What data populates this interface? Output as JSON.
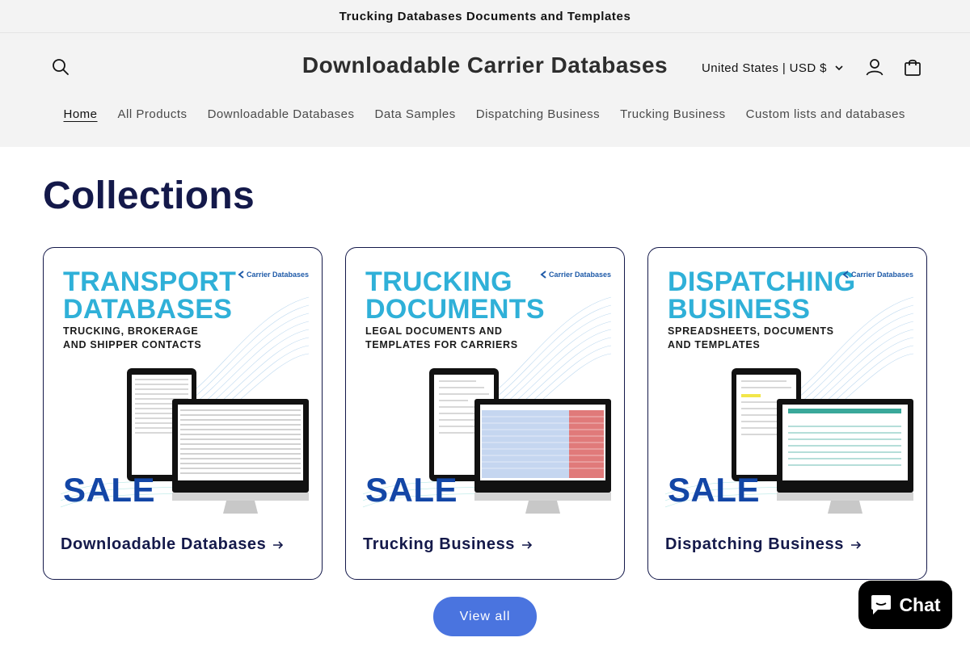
{
  "announcement": {
    "text": "Trucking Databases Documents and Templates"
  },
  "header": {
    "site_title": "Downloadable Carrier Databases",
    "locale": "United States | USD $",
    "icons": {
      "search": "search-icon",
      "account": "account-icon",
      "cart": "cart-icon",
      "locale_chevron": "chevron-down-icon"
    }
  },
  "nav": {
    "items": [
      {
        "label": "Home",
        "active": true
      },
      {
        "label": "All Products"
      },
      {
        "label": "Downloadable Databases"
      },
      {
        "label": "Data Samples"
      },
      {
        "label": "Dispatching Business"
      },
      {
        "label": "Trucking Business"
      },
      {
        "label": "Custom lists and databases"
      }
    ]
  },
  "main": {
    "title": "Collections",
    "cards": [
      {
        "label": "Downloadable Databases",
        "image": {
          "heading_line1": "TRANSPORT",
          "heading_line2": "DATABASES",
          "sub_line1": "TRUCKING, BROKERAGE",
          "sub_line2": "AND SHIPPER CONTACTS",
          "brand": "Carrier Databases",
          "sale": "SALE"
        }
      },
      {
        "label": "Trucking Business",
        "image": {
          "heading_line1": "TRUCKING",
          "heading_line2": "DOCUMENTS",
          "sub_line1": "LEGAL DOCUMENTS AND",
          "sub_line2": "TEMPLATES FOR CARRIERS",
          "brand": "Carrier Databases",
          "sale": "SALE"
        }
      },
      {
        "label": "Dispatching Business",
        "image": {
          "heading_line1": "DISPATCHING",
          "heading_line2": "BUSINESS",
          "sub_line1": "SPREADSHEETS, DOCUMENTS",
          "sub_line2": "AND TEMPLATES",
          "brand": "Carrier Databases",
          "sale": "SALE"
        }
      }
    ],
    "view_all": "View all"
  },
  "chat": {
    "label": "Chat",
    "icon": "chat-bubble-icon"
  },
  "colors": {
    "accent": "#4a74df",
    "title": "#14194a",
    "header_bg": "#f3f3f3",
    "promo_heading": "#2fb0d8",
    "promo_sale": "#1346a6"
  }
}
